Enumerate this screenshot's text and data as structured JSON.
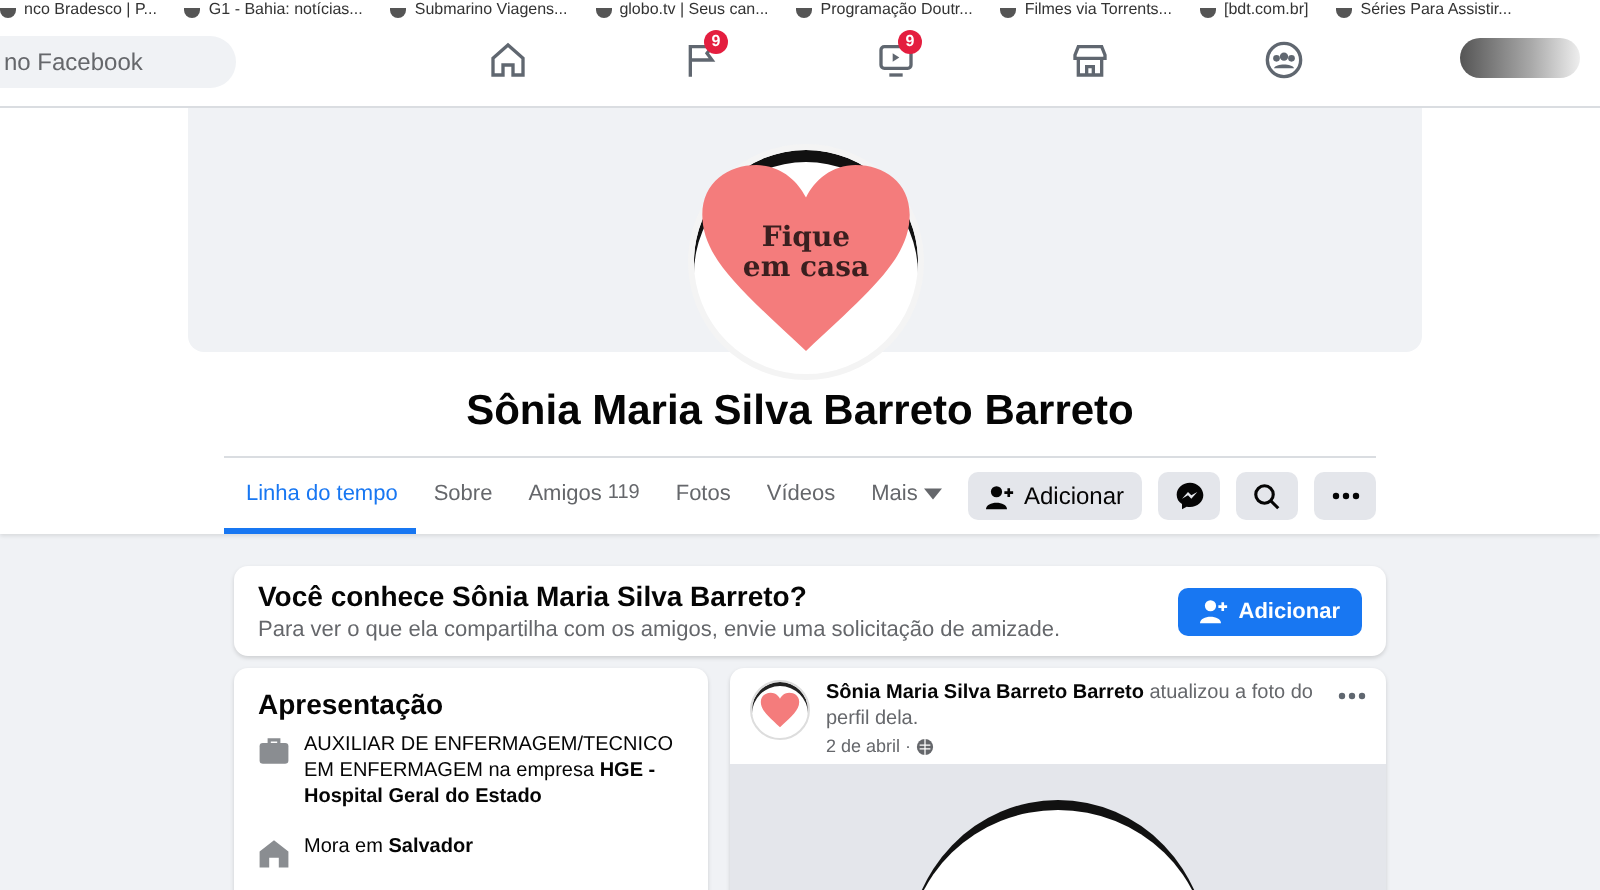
{
  "bookmarks": [
    "nco Bradesco | P...",
    "G1 - Bahia: notícias...",
    "Submarino Viagens...",
    "globo.tv | Seus can...",
    "Programação Doutr...",
    "Filmes via Torrents...",
    "[bdt.com.br]",
    "Séries Para Assistir..."
  ],
  "search": {
    "placeholder": "no Facebook"
  },
  "nav": [
    {
      "kind": "home",
      "selected": false
    },
    {
      "kind": "flag",
      "badge": "9",
      "selected": false
    },
    {
      "kind": "video",
      "badge": "9",
      "selected": false
    },
    {
      "kind": "store",
      "selected": false
    },
    {
      "kind": "groups",
      "selected": false
    }
  ],
  "profile": {
    "picture_caption": "Fique em casa",
    "name": "Sônia Maria Silva Barreto Barreto"
  },
  "tabs": [
    {
      "label": "Linha do tempo",
      "selected": true,
      "dropdown": false
    },
    {
      "label": "Sobre",
      "selected": false,
      "dropdown": false
    },
    {
      "label": "Amigos",
      "count": "119",
      "selected": false,
      "dropdown": false
    },
    {
      "label": "Fotos",
      "selected": false,
      "dropdown": false
    },
    {
      "label": "Vídeos",
      "selected": false,
      "dropdown": false
    },
    {
      "label": "Mais",
      "selected": false,
      "dropdown": true
    }
  ],
  "actions": {
    "add": "Adicionar"
  },
  "suggest": {
    "title": "Você conhece Sônia Maria Silva Barreto?",
    "text": "Para ver o que ela compartilha com os amigos, envie uma solicitação de amizade.",
    "button": "Adicionar"
  },
  "intro": {
    "title": "Apresentação",
    "items": [
      {
        "kind": "work",
        "text": "AUXILIAR DE ENFERMAGEM/TECNICO EM ENFERMAGEM na empresa **HGE - Hospital Geral do Estado**"
      },
      {
        "kind": "home",
        "text": "Mora em **Salvador**"
      }
    ]
  },
  "post": {
    "author": "Sônia Maria Silva Barreto Barreto",
    "action": "atualizou a foto do perfil dela.",
    "date": "2 de abril ·"
  }
}
